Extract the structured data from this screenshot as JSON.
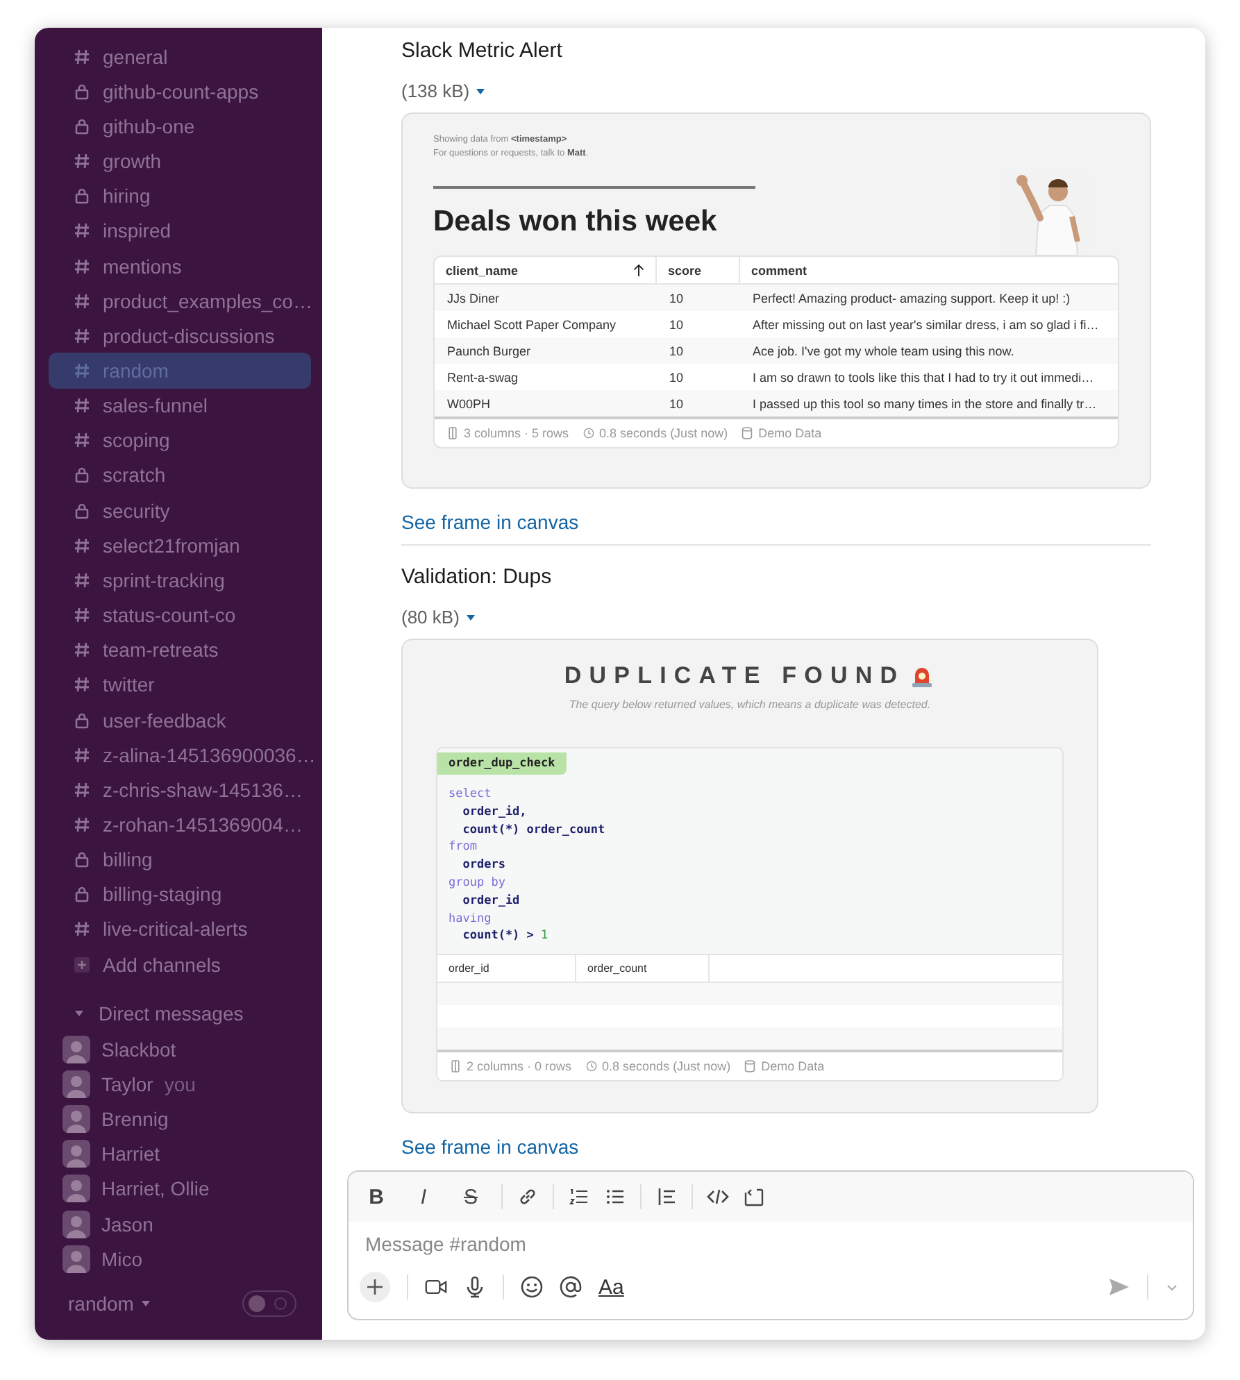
{
  "sidebar": {
    "channels": [
      {
        "kind": "public",
        "label": "general",
        "selected": false
      },
      {
        "kind": "private",
        "label": "github-count-apps",
        "selected": false
      },
      {
        "kind": "private",
        "label": "github-one",
        "selected": false
      },
      {
        "kind": "public",
        "label": "growth",
        "selected": false
      },
      {
        "kind": "private",
        "label": "hiring",
        "selected": false
      },
      {
        "kind": "public",
        "label": "inspired",
        "selected": false
      },
      {
        "kind": "public",
        "label": "mentions",
        "selected": false
      },
      {
        "kind": "public",
        "label": "product_examples_co…",
        "selected": false
      },
      {
        "kind": "public",
        "label": "product-discussions",
        "selected": false
      },
      {
        "kind": "public",
        "label": "random",
        "selected": true
      },
      {
        "kind": "public",
        "label": "sales-funnel",
        "selected": false
      },
      {
        "kind": "public",
        "label": "scoping",
        "selected": false
      },
      {
        "kind": "private",
        "label": "scratch",
        "selected": false
      },
      {
        "kind": "private",
        "label": "security",
        "selected": false
      },
      {
        "kind": "public",
        "label": "select21fromjan",
        "selected": false
      },
      {
        "kind": "public",
        "label": "sprint-tracking",
        "selected": false
      },
      {
        "kind": "public",
        "label": "status-count-co",
        "selected": false
      },
      {
        "kind": "public",
        "label": "team-retreats",
        "selected": false
      },
      {
        "kind": "public",
        "label": "twitter",
        "selected": false
      },
      {
        "kind": "private",
        "label": "user-feedback",
        "selected": false
      },
      {
        "kind": "public",
        "label": "z-alina-145136900036…",
        "selected": false
      },
      {
        "kind": "public",
        "label": "z-chris-shaw-145136…",
        "selected": false
      },
      {
        "kind": "public",
        "label": "z-rohan-1451369004…",
        "selected": false
      },
      {
        "kind": "private",
        "label": "billing",
        "selected": false
      },
      {
        "kind": "private",
        "label": "billing-staging",
        "selected": false
      },
      {
        "kind": "public",
        "label": "live-critical-alerts",
        "selected": false
      },
      {
        "kind": "add",
        "label": "Add channels",
        "selected": false
      }
    ],
    "dm_header": "Direct messages",
    "direct_messages": [
      {
        "name": "Slackbot"
      },
      {
        "name": "Taylor",
        "note": "you"
      },
      {
        "name": "Brennig"
      },
      {
        "name": "Harriet"
      },
      {
        "name": "Harriet, Ollie"
      },
      {
        "name": "Jason"
      },
      {
        "name": "Mico"
      }
    ],
    "footer": "random"
  },
  "messages": [
    {
      "title": "Slack Metric Alert",
      "size": "(138 kB)",
      "kind": "report",
      "meta": [
        "Showing data from **<timestamp>**",
        "For questions or requests, talk to **Matt**."
      ],
      "heading": "Deals won this week",
      "table": {
        "columns": [
          {
            "label": "client_name",
            "sorted": true
          },
          {
            "label": "score",
            "sorted": false
          },
          {
            "label": "comment",
            "sorted": false
          }
        ],
        "rows": [
          [
            "JJs Diner",
            "10",
            "Perfect! Amazing product- amazing support. Keep it up! :)"
          ],
          [
            "Michael Scott Paper Company",
            "10",
            "After missing out on last year's similar dress, i am so glad i fi…"
          ],
          [
            "Paunch Burger",
            "10",
            "Ace job. I've got my whole team using this now."
          ],
          [
            "Rent-a-swag",
            "10",
            "I am so drawn to tools like this that I had to try it out immedi…"
          ],
          [
            "W00PH",
            "10",
            "I passed up this tool so many times in the store and finally tr…"
          ]
        ],
        "footer": [
          "3 columns · 5 rows",
          "0.8 seconds (Just now)",
          "Demo Data"
        ]
      },
      "link": "See frame in canvas"
    },
    {
      "title": "Validation: Dups",
      "size": "(80 kB)",
      "kind": "check",
      "heading": "DUPLICATE FOUND",
      "subtitle": "The query below returned values, which means a duplicate was detected.",
      "query_name": "order_dup_check",
      "code": [
        [
          {
            "kind": "keyword",
            "text": "select"
          }
        ],
        [
          {
            "kind": "ident",
            "text": "  order_id,"
          }
        ],
        [
          {
            "kind": "ident",
            "text": "  count(*) order_count"
          }
        ],
        [
          {
            "kind": "keyword",
            "text": "from"
          }
        ],
        [
          {
            "kind": "ident",
            "text": "  orders"
          }
        ],
        [
          {
            "kind": "keyword",
            "text": "group by"
          }
        ],
        [
          {
            "kind": "ident",
            "text": "  order_id"
          }
        ],
        [
          {
            "kind": "keyword",
            "text": "having"
          }
        ],
        [
          {
            "kind": "ident",
            "text": "  count(*) > "
          },
          {
            "kind": "number",
            "text": "1"
          }
        ]
      ],
      "table": {
        "columns": [
          {
            "label": "order_id",
            "sorted": false
          },
          {
            "label": "order_count",
            "sorted": false
          }
        ],
        "footer": [
          "2 columns · 0 rows",
          "0.8 seconds (Just now)",
          "Demo Data"
        ]
      },
      "link": "See frame in canvas"
    }
  ],
  "composer": {
    "format_buttons": [
      {
        "kind": "bold",
        "label": "B"
      },
      {
        "kind": "italic",
        "label": "I"
      },
      {
        "kind": "strike",
        "label": "S"
      }
    ],
    "placeholder": "Message #random",
    "text_style": "Aa"
  }
}
